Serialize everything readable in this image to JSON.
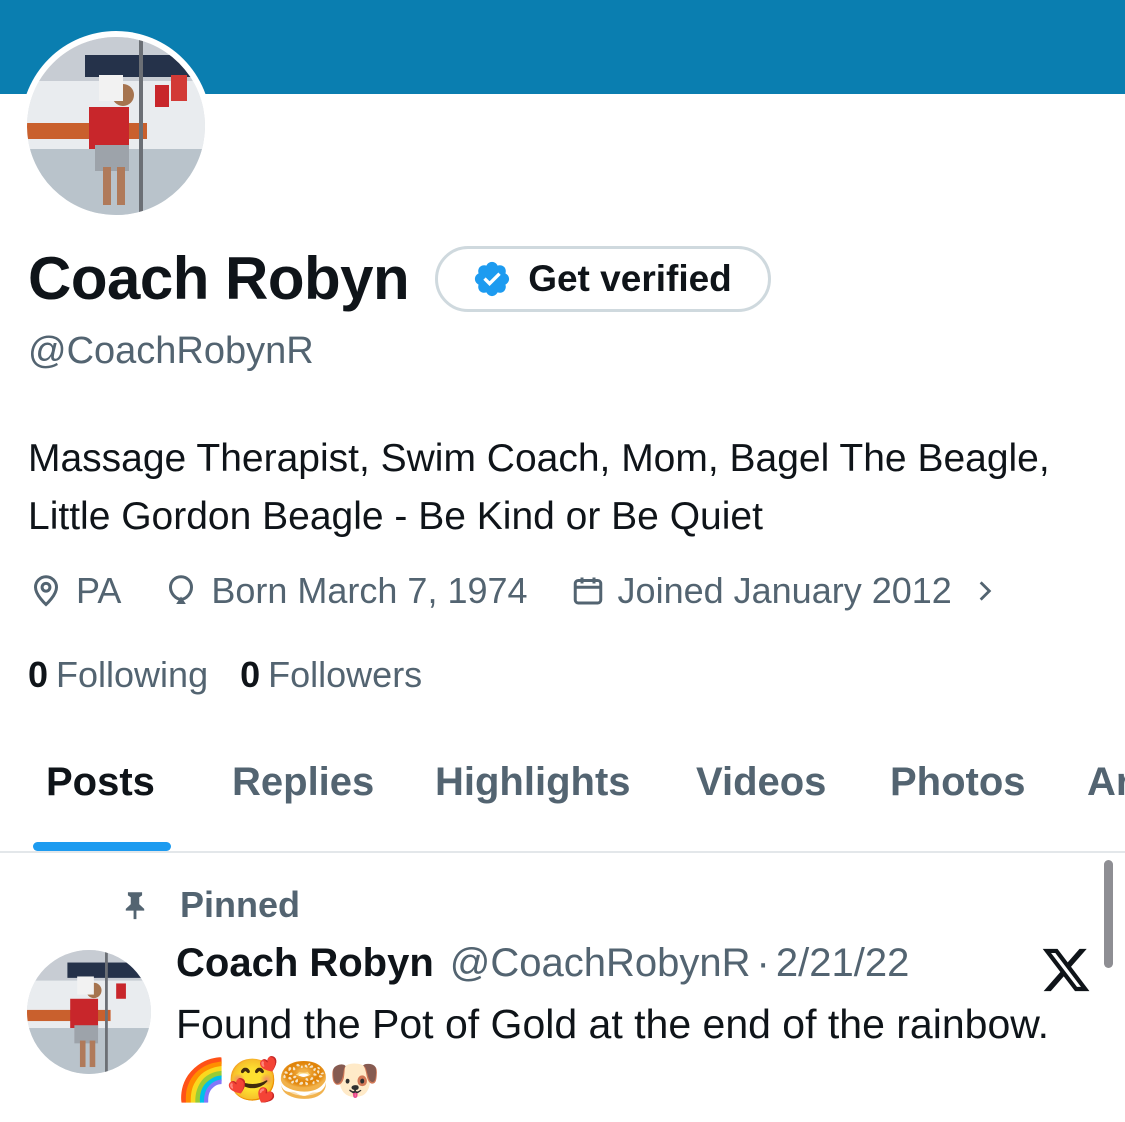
{
  "profile": {
    "display_name": "Coach Robyn",
    "get_verified_label": "Get verified",
    "handle": "@CoachRobynR",
    "bio": "Massage Therapist, Swim Coach, Mom, Bagel The Beagle, Little Gordon Beagle - Be Kind or Be Quiet",
    "location": "PA",
    "birthday": "Born March 7, 1974",
    "joined": "Joined January 2012",
    "following_count": "0",
    "following_label": "Following",
    "followers_count": "0",
    "followers_label": "Followers"
  },
  "tabs": [
    "Posts",
    "Replies",
    "Highlights",
    "Videos",
    "Photos",
    "Ar"
  ],
  "active_tab": "Posts",
  "pinned_post": {
    "pinned_label": "Pinned",
    "author_name": "Coach Robyn",
    "author_handle": "@CoachRobynR",
    "separator": "·",
    "date": "2/21/22",
    "text": "Found the Pot of Gold at the end of the rainbow.🌈🥰🥯🐶"
  },
  "colors": {
    "banner": "#0a7eb0",
    "accent": "#1d9bf0",
    "text_primary": "#0f1419",
    "text_secondary": "#536471"
  },
  "icons": {
    "location": "location-pin-icon",
    "birthday": "balloon-icon",
    "joined": "calendar-icon",
    "verified": "verified-badge-icon",
    "pinned": "pin-icon",
    "menu": "x-logo-icon"
  }
}
